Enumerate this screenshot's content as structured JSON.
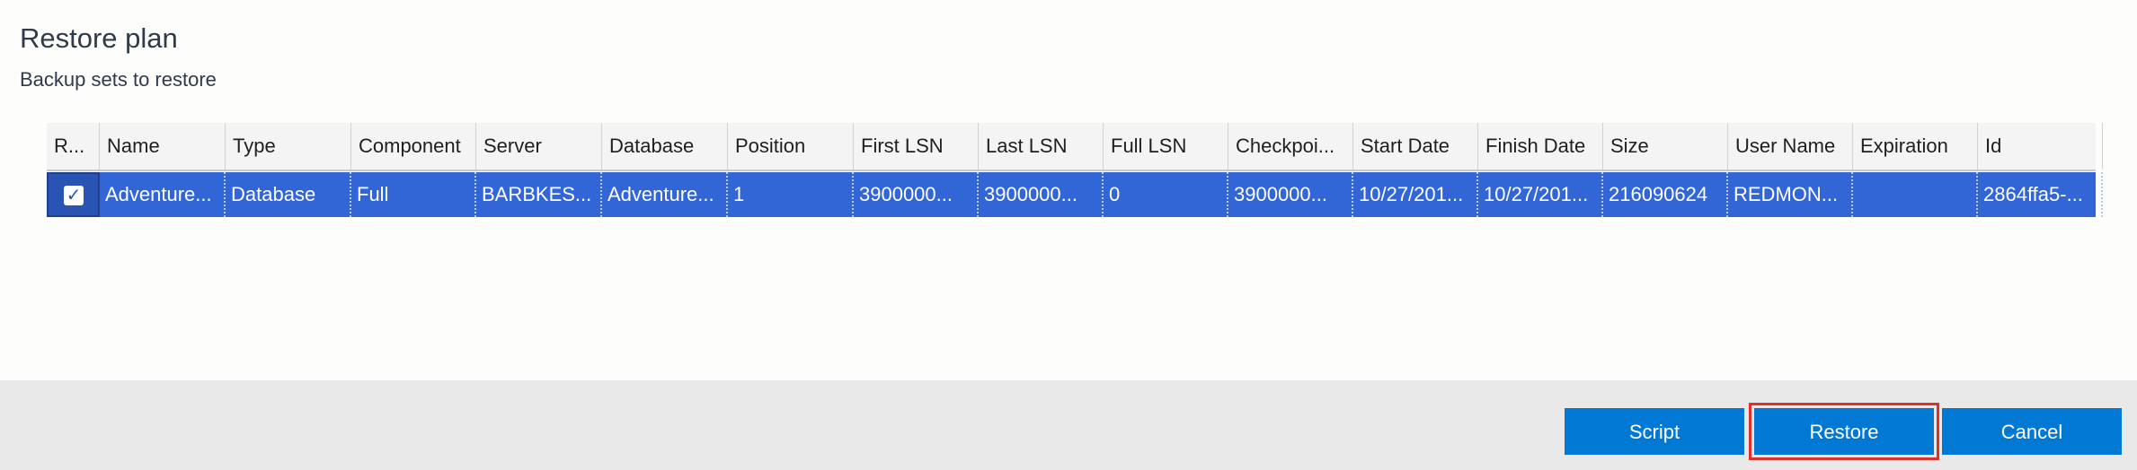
{
  "header": {
    "title": "Restore plan",
    "subtitle": "Backup sets to restore"
  },
  "table": {
    "columns": [
      "R...",
      "Name",
      "Type",
      "Component",
      "Server",
      "Database",
      "Position",
      "First LSN",
      "Last LSN",
      "Full LSN",
      "Checkpoi...",
      "Start Date",
      "Finish Date",
      "Size",
      "User Name",
      "Expiration",
      "Id"
    ],
    "rows": [
      {
        "restore_checked": true,
        "cells": [
          "Adventure...",
          "Database",
          "Full",
          "BARBKES...",
          "Adventure...",
          "1",
          "3900000...",
          "3900000...",
          "0",
          "3900000...",
          "10/27/201...",
          "10/27/201...",
          "216090624",
          "REDMON...",
          "",
          "2864ffa5-..."
        ]
      }
    ]
  },
  "buttons": {
    "script": "Script",
    "restore": "Restore",
    "cancel": "Cancel"
  },
  "colors": {
    "accent": "#0078d4",
    "selected_row": "#3266d6",
    "focus_outline": "#e0302a"
  },
  "icons": {
    "checkbox": "check-icon"
  }
}
